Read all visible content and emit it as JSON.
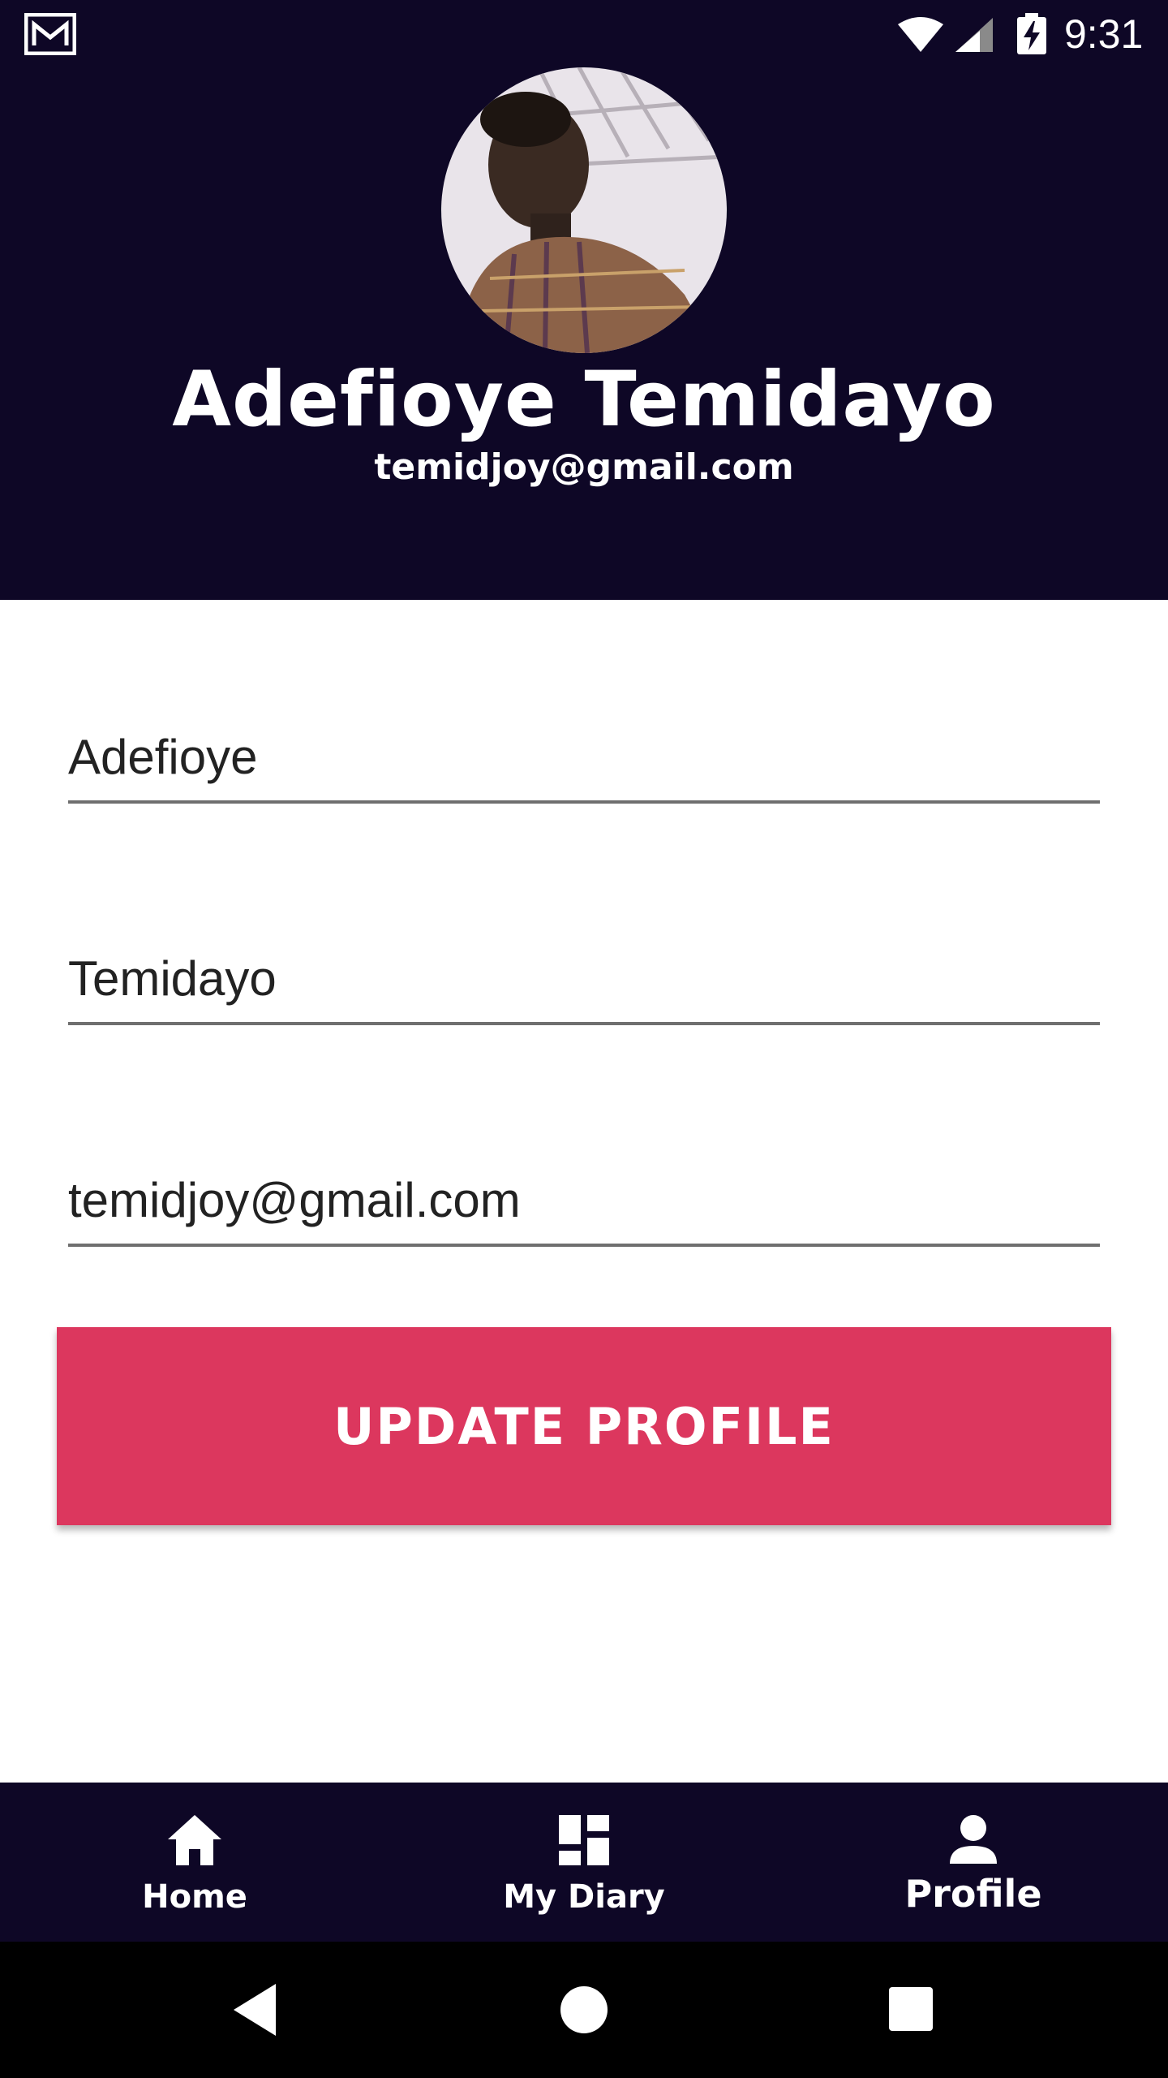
{
  "status_bar": {
    "time": "9:31",
    "icons": [
      "gallery-icon",
      "wifi-icon",
      "signal-icon",
      "battery-charging-icon"
    ]
  },
  "profile": {
    "name": "Adefioye Temidayo",
    "email": "temidjoy@gmail.com",
    "avatar": "user-photo"
  },
  "form": {
    "first_name": "Adefioye",
    "last_name": "Temidayo",
    "email": "temidjoy@gmail.com"
  },
  "update_button_label": "UPDATE PROFILE",
  "bottom_nav": {
    "items": [
      {
        "label": "Home",
        "icon": "home-icon"
      },
      {
        "label": "My Diary",
        "icon": "dashboard-icon"
      },
      {
        "label": "Profile",
        "icon": "person-icon",
        "active": true
      }
    ]
  },
  "system_nav": {
    "icons": [
      "back-icon",
      "home-circle-icon",
      "recents-icon"
    ]
  },
  "colors": {
    "header_bg": "#0e0726",
    "button_bg": "#dc375e",
    "text_light": "#ffffff",
    "text_dark": "#222222",
    "underline": "#6f6f6f"
  }
}
